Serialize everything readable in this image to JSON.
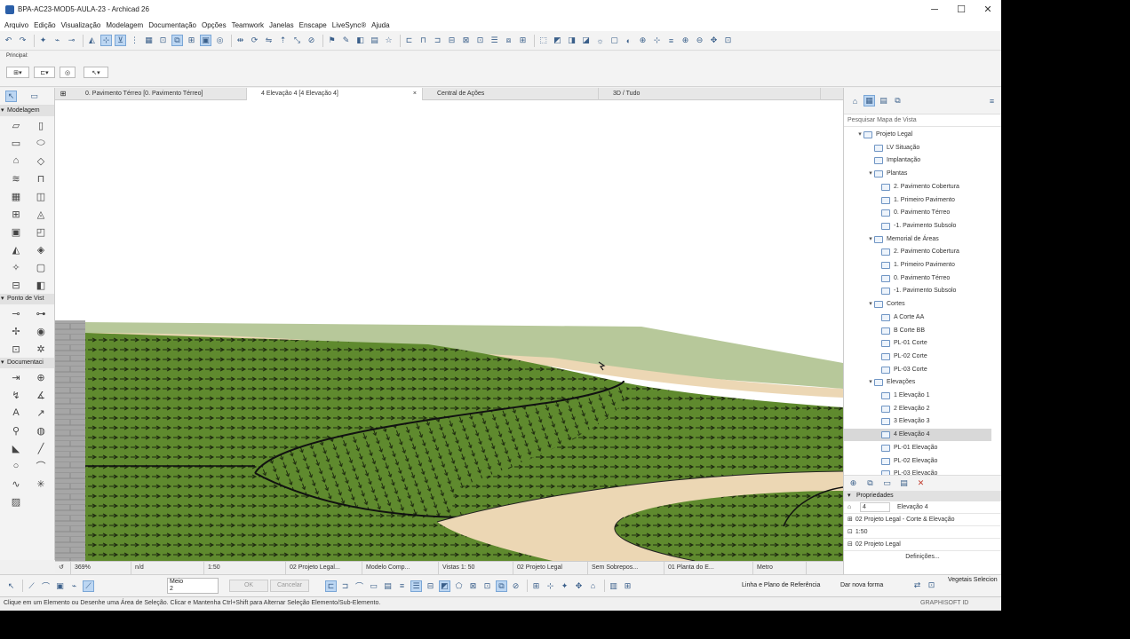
{
  "window": {
    "title": "BPA-AC23-MOD5-AULA-23 - Archicad 26",
    "controls": [
      "─",
      "☐",
      "✕"
    ]
  },
  "menu": [
    "Arquivo",
    "Edição",
    "Visualização",
    "Modelagem",
    "Documentação",
    "Opções",
    "Teamwork",
    "Janelas",
    "Enscape",
    "LiveSync®",
    "Ajuda"
  ],
  "infobox": {
    "label": "Principal:"
  },
  "toolbox": {
    "sections": [
      {
        "label": "Modelagem"
      },
      {
        "label": "Ponto de Vist"
      },
      {
        "label": "Documentaci"
      }
    ]
  },
  "tabs": [
    {
      "label": "0. Pavimento Térreo [0. Pavimento Térreo]"
    },
    {
      "label": "4 Elevação 4 [4 Elevação 4]"
    },
    {
      "label": "Central de Ações"
    },
    {
      "label": "3D / Tudo"
    }
  ],
  "status": {
    "zoom": "369%",
    "angle": "n/d",
    "scale": "1:50",
    "layer_combo": "02 Projeto Legal...",
    "model_view": "Modelo Comp...",
    "views": "Vistas 1: 50",
    "pen_set": "02 Projeto Legal",
    "overrides": "Sem Sobrepos...",
    "renovation": "01 Planta do E...",
    "unit": "Metro"
  },
  "bottombar": {
    "geometry": "Meio",
    "geometry_value": "2",
    "ok_label": "OK",
    "cancel_label": "Cancelar",
    "reference": "Linha e Plano de Referência",
    "draw_shape": "Dar nova forma",
    "selection": "Vegetais Selecion"
  },
  "footer": {
    "hint": "Clique em um Elemento ou Desenhe uma Área de Seleção. Clicar e Mantenha Ctrl+Shift para Alternar Seleção Elemento/Sub-Elemento.",
    "brand": "GRAPHISOFT ID"
  },
  "navigator": {
    "search_placeholder": "Pesquisar Mapa de Vista",
    "items": [
      {
        "label": "Projeto Legal",
        "level": 0
      },
      {
        "label": "LV Situação",
        "level": 1
      },
      {
        "label": "Implantação",
        "level": 1
      },
      {
        "label": "Plantas",
        "level": 1
      },
      {
        "label": "2. Pavimento Cobertura",
        "level": 2
      },
      {
        "label": "1. Primeiro Pavimento",
        "level": 2
      },
      {
        "label": "0. Pavimento Térreo",
        "level": 2
      },
      {
        "label": "-1. Pavimento Subsolo",
        "level": 2
      },
      {
        "label": "Memorial de Áreas",
        "level": 1
      },
      {
        "label": "2. Pavimento Cobertura",
        "level": 2
      },
      {
        "label": "1. Primeiro Pavimento",
        "level": 2
      },
      {
        "label": "0. Pavimento Térreo",
        "level": 2
      },
      {
        "label": "-1. Pavimento Subsolo",
        "level": 2
      },
      {
        "label": "Cortes",
        "level": 1
      },
      {
        "label": "A Corte AA",
        "level": 2
      },
      {
        "label": "B Corte BB",
        "level": 2
      },
      {
        "label": "PL-01 Corte",
        "level": 2
      },
      {
        "label": "PL-02 Corte",
        "level": 2
      },
      {
        "label": "PL-03 Corte",
        "level": 2
      },
      {
        "label": "Elevações",
        "level": 1
      },
      {
        "label": "1 Elevação 1",
        "level": 2
      },
      {
        "label": "2 Elevação 2",
        "level": 2
      },
      {
        "label": "3 Elevação 3",
        "level": 2
      },
      {
        "label": "4 Elevação 4",
        "level": 2,
        "selected": true
      },
      {
        "label": "PL-01 Elevação",
        "level": 2
      },
      {
        "label": "PL-02 Elevação",
        "level": 2
      },
      {
        "label": "PL-03 Elevação",
        "level": 2
      }
    ]
  },
  "properties": {
    "header": "Propriedades",
    "id": "4",
    "name": "Elevação 4",
    "path": "02 Projeto Legal - Corte & Elevação",
    "scale": "1:50",
    "layer": "02 Projeto Legal",
    "definitions_button": "Definições..."
  },
  "colors": {
    "grass": "#5f8a2e",
    "path": "#ecd7b4",
    "terrain_light": "#b7c89a",
    "selection_bg": "#d8d8d8"
  }
}
